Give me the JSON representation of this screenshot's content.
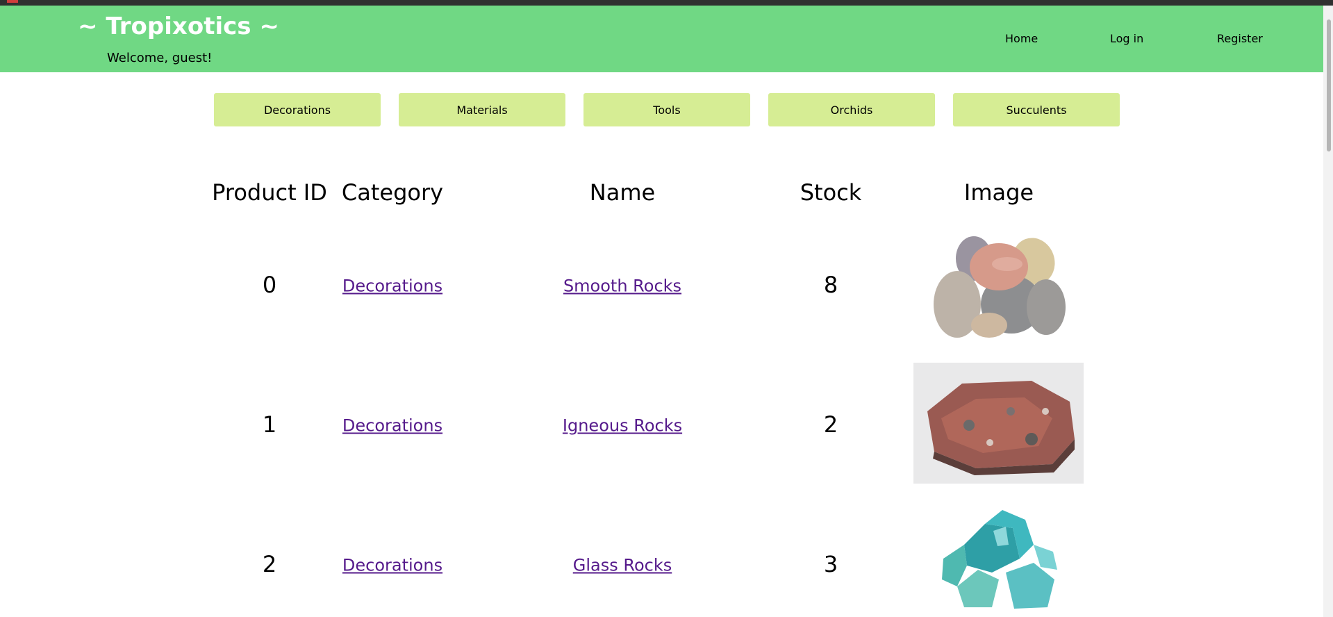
{
  "header": {
    "logo": "~ Tropixotics ~",
    "welcome": "Welcome, guest!",
    "nav": [
      "Home",
      "Log in",
      "Register"
    ]
  },
  "categories": [
    "Decorations",
    "Materials",
    "Tools",
    "Orchids",
    "Succulents"
  ],
  "table": {
    "headers": [
      "Product ID",
      "Category",
      "Name",
      "Stock",
      "Image"
    ],
    "rows": [
      {
        "id": "0",
        "category": "Decorations",
        "name": "Smooth Rocks",
        "stock": "8",
        "image": "smooth-rocks-image"
      },
      {
        "id": "1",
        "category": "Decorations",
        "name": "Igneous Rocks",
        "stock": "2",
        "image": "igneous-rocks-image"
      },
      {
        "id": "2",
        "category": "Decorations",
        "name": "Glass Rocks",
        "stock": "3",
        "image": "glass-rocks-image"
      }
    ]
  },
  "colors": {
    "header_bg": "#70d884",
    "category_button_bg": "#d6ed94",
    "link": "#551a8b"
  }
}
